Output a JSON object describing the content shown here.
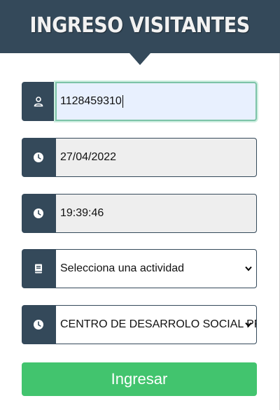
{
  "header": {
    "title": "INGRESO VISITANTES"
  },
  "form": {
    "document_value": "1128459310",
    "date_value": "27/04/2022",
    "time_value": "19:39:46",
    "activity_selected": "Selecciona una actividad",
    "center_selected": "CENTRO DE DESARROLO SOCIAL PRADO"
  },
  "icons": {
    "document": "user-icon",
    "date": "clock-icon",
    "time": "clock-icon",
    "activity": "book-icon",
    "center": "clock-icon"
  },
  "submit_label": "Ingresar",
  "colors": {
    "header_bg": "#34495a",
    "icon_bg": "#34495a",
    "button_bg": "#42c46e",
    "active_field_bg": "#e8f0fe"
  }
}
